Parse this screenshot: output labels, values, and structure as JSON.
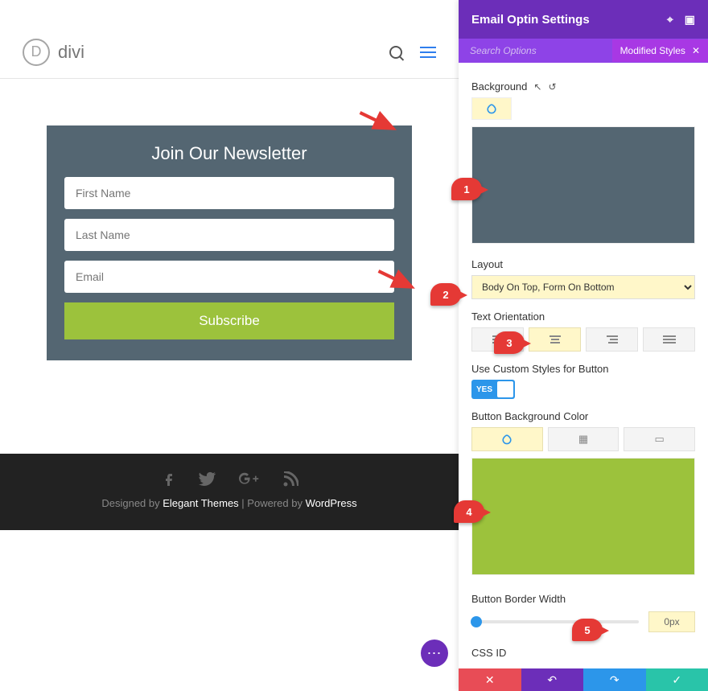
{
  "wp_badge": "*",
  "site": {
    "logo_letter": "D",
    "logo_text": "divi"
  },
  "optin": {
    "title": "Join Our Newsletter",
    "first_ph": "First Name",
    "last_ph": "Last Name",
    "email_ph": "Email",
    "submit": "Subscribe"
  },
  "footer": {
    "designed": "Designed by ",
    "et": "Elegant Themes",
    "sep": " | Powered by ",
    "wp": "WordPress"
  },
  "panel": {
    "title": "Email Optin Settings",
    "search_ph": "Search Options",
    "tag": "Modified Styles",
    "background_label": "Background",
    "layout_label": "Layout",
    "layout_value": "Body On Top, Form On Bottom",
    "orient_label": "Text Orientation",
    "custom_btn_label": "Use Custom Styles for Button",
    "toggle_yes": "YES",
    "btn_bg_label": "Button Background Color",
    "border_label": "Button Border Width",
    "border_value": "0px",
    "cssid_label": "CSS ID",
    "colors": {
      "module_bg": "#546672",
      "button_bg": "#9cc23c"
    }
  },
  "annotations": {
    "p1": "1",
    "p2": "2",
    "p3": "3",
    "p4": "4",
    "p5": "5"
  }
}
